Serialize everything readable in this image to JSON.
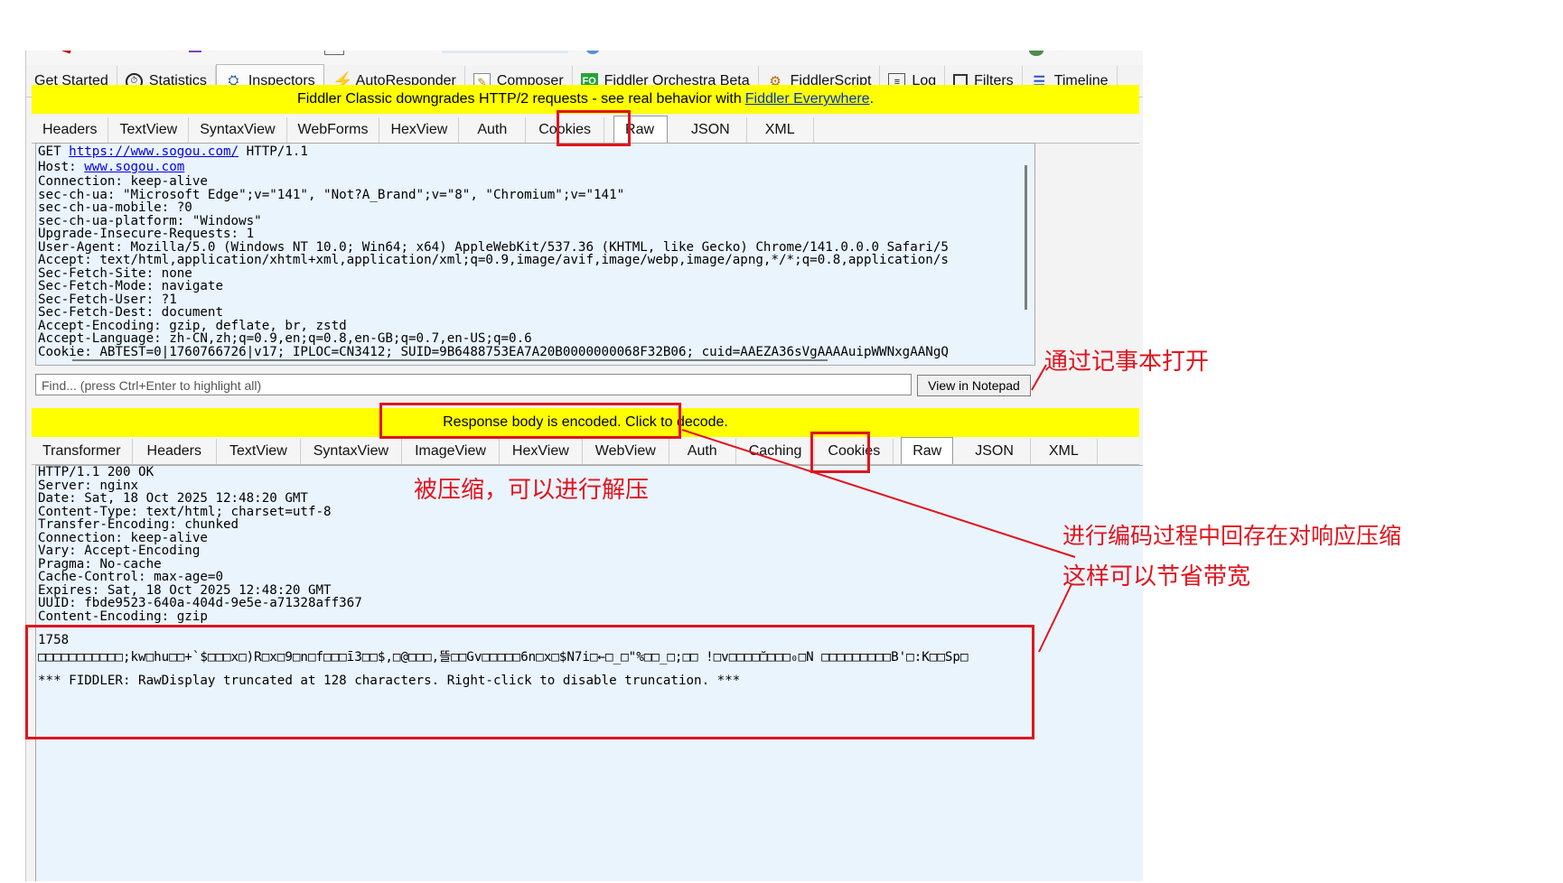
{
  "main_tabs": [
    {
      "label": "Get Started",
      "icon": ""
    },
    {
      "label": "Statistics",
      "icon": "clock-icon"
    },
    {
      "label": "Inspectors",
      "icon": "inspectors-icon"
    },
    {
      "label": "AutoResponder",
      "icon": "bolt-icon"
    },
    {
      "label": "Composer",
      "icon": "composer-icon"
    },
    {
      "label": "Fiddler Orchestra Beta",
      "icon": "fo-icon",
      "icon_text": "FO"
    },
    {
      "label": "FiddlerScript",
      "icon": "script-icon"
    },
    {
      "label": "Log",
      "icon": "log-icon"
    },
    {
      "label": "Filters",
      "icon": "checkbox-icon"
    },
    {
      "label": "Timeline",
      "icon": "timeline-icon"
    }
  ],
  "banner_http2": {
    "text": "Fiddler Classic downgrades HTTP/2 requests - see real behavior with",
    "link": "Fiddler Everywhere",
    "suffix": ".",
    "color": "#ffff00"
  },
  "request": {
    "tabs": [
      "Headers",
      "TextView",
      "SyntaxView",
      "WebForms",
      "HexView",
      "Auth",
      "Cookies",
      "Raw",
      "JSON",
      "XML"
    ],
    "selected_tab": "Raw",
    "line1_method": "GET ",
    "line1_url": "https://www.sogou.com/",
    "line1_version": " HTTP/1.1",
    "host_label": "Host: ",
    "host_value": "www.sogou.com",
    "headers": [
      "Connection: keep-alive",
      "sec-ch-ua: \"Microsoft Edge\";v=\"141\", \"Not?A_Brand\";v=\"8\", \"Chromium\";v=\"141\"",
      "sec-ch-ua-mobile: ?0",
      "sec-ch-ua-platform: \"Windows\"",
      "Upgrade-Insecure-Requests: 1",
      "User-Agent: Mozilla/5.0 (Windows NT 10.0; Win64; x64) AppleWebKit/537.36 (KHTML, like Gecko) Chrome/141.0.0.0 Safari/5",
      "Accept: text/html,application/xhtml+xml,application/xml;q=0.9,image/avif,image/webp,image/apng,*/*;q=0.8,application/s",
      "Sec-Fetch-Site: none",
      "Sec-Fetch-Mode: navigate",
      "Sec-Fetch-User: ?1",
      "Sec-Fetch-Dest: document",
      "Accept-Encoding: gzip, deflate, br, zstd",
      "Accept-Language: zh-CN,zh;q=0.9,en;q=0.8,en-GB;q=0.7,en-US;q=0.6",
      "Cookie: ABTEST=0|1760766726|v17; IPLOC=CN3412; SUID=9B6488753EA7A20B0000000068F32B06; cuid=AAEZA36sVgAAAAuipWWNxgAANgQ"
    ],
    "find_placeholder": "Find... (press Ctrl+Enter to highlight all)",
    "view_notepad_label": "View in Notepad"
  },
  "banner_encoded": {
    "text": "Response body is encoded. Click to decode.",
    "color": "#ffff00"
  },
  "response": {
    "tabs": [
      "Transformer",
      "Headers",
      "TextView",
      "SyntaxView",
      "ImageView",
      "HexView",
      "WebView",
      "Auth",
      "Caching",
      "Cookies",
      "Raw",
      "JSON",
      "XML"
    ],
    "selected_tab": "Raw",
    "headers": [
      "HTTP/1.1 200 OK",
      "Server: nginx",
      "Date: Sat, 18 Oct 2025 12:48:20 GMT",
      "Content-Type: text/html; charset=utf-8",
      "Transfer-Encoding: chunked",
      "Connection: keep-alive",
      "Vary: Accept-Encoding",
      "Pragma: No-cache",
      "Cache-Control: max-age=0",
      "Expires: Sat, 18 Oct 2025 12:48:20 GMT",
      "UUID: fbde9523-640a-404d-9e5e-a71328aff367",
      "Content-Encoding: gzip"
    ],
    "chunk_size": "1758",
    "binary_line": "□□□□□□□□□□□;kw□hu□□+`$□□□x□)R□x□9□n□f□□□ī3□□$,□@□□□,뜰□□Gv□□□□□6n□x□$N7i□←□_□\"%□□_□;□□ !□v□□□□̆□□□□₀□N □□□□□□□□□B'□:K□□Sp□",
    "truncation_note": "*** FIDDLER: RawDisplay truncated at 128 characters. Right-click to disable truncation. ***"
  },
  "annotations": {
    "notepad": "通过记事本打开",
    "compressed": "被压缩，可以进行解压",
    "explain_line1": "进行编码过程中回存在对响应压缩",
    "explain_line2": "这样可以节省带宽",
    "color": "#e0141e"
  }
}
